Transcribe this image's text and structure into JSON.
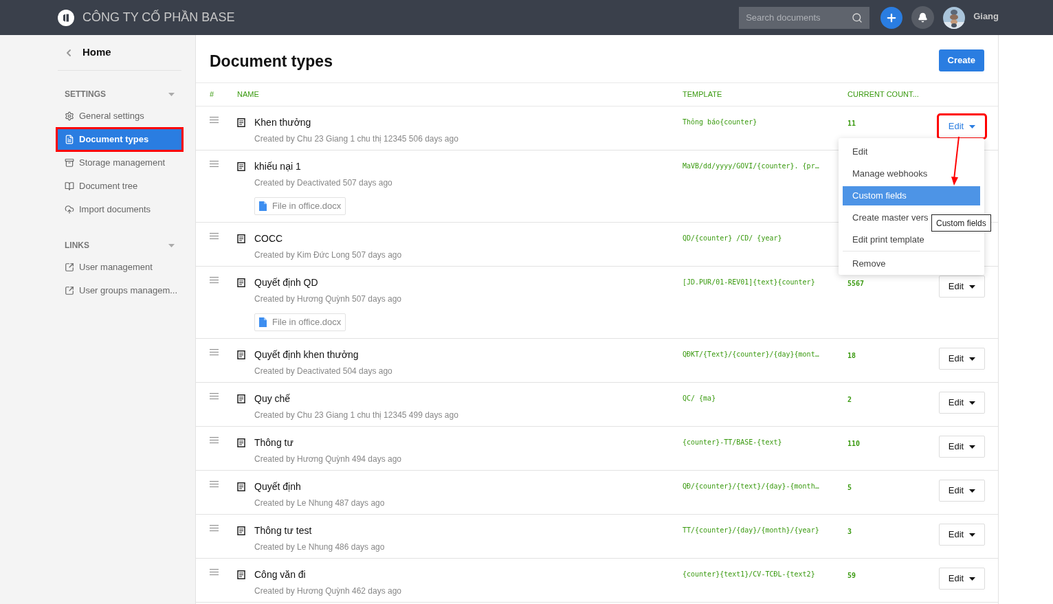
{
  "header": {
    "company": "CÔNG TY CỐ PHẦN BASE",
    "search": {
      "placeholder": "Search documents"
    },
    "user": "Giang"
  },
  "sidebar": {
    "back": "Home",
    "sections": [
      {
        "title": "SETTINGS",
        "items": [
          {
            "label": "General settings",
            "selected": false,
            "annotated": false
          },
          {
            "label": "Document types",
            "selected": true,
            "annotated": true
          },
          {
            "label": "Storage management",
            "selected": false,
            "annotated": false
          },
          {
            "label": "Document tree",
            "selected": false,
            "annotated": false
          },
          {
            "label": "Import documents",
            "selected": false,
            "annotated": false
          }
        ]
      },
      {
        "title": "LINKS",
        "items": [
          {
            "label": "User management",
            "selected": false,
            "annotated": false
          },
          {
            "label": "User groups managem...",
            "selected": false,
            "annotated": false
          }
        ]
      }
    ]
  },
  "page": {
    "title": "Document types",
    "create": "Create"
  },
  "table": {
    "columns": [
      "#",
      "NAME",
      "TEMPLATE",
      "CURRENT COUNT..."
    ],
    "rows": [
      {
        "name": "Khen thưởng",
        "creator": "Created by Chu 23 Giang 1 chu thị 12345 506 days ago",
        "template": "Thông báo{counter}",
        "count": "11",
        "edit": "Edit",
        "menu_open": true
      },
      {
        "name": "khiếu nại 1",
        "creator": "Created by Deactivated 507 days ago",
        "template": "MaVB/dd/yyyy/GOVI/{counter}. {pr…",
        "attachment": "File in office.docx",
        "menu_open": false
      },
      {
        "name": "COCC",
        "creator": "Created by Kim Đức Long 507 days ago",
        "template": "QD/{counter} /CD/ {year}",
        "menu_open": false
      },
      {
        "name": "Quyết định QD",
        "creator": "Created by Hương Quỳnh 507 days ago",
        "template": "[JD.PUR/01-REV01]{text}{counter}",
        "count": "5567",
        "edit": "Edit",
        "attachment": "File in office.docx",
        "menu_open": false
      },
      {
        "name": "Quyết định khen thưởng",
        "creator": "Created by Deactivated 504 days ago",
        "template": "QĐKT/{Text}/{counter}/{day}{mont…",
        "count": "18",
        "edit": "Edit",
        "menu_open": false
      },
      {
        "name": "Quy chế",
        "creator": "Created by Chu 23 Giang 1 chu thị 12345 499 days ago",
        "template": "QC/ {ma}",
        "count": "2",
        "edit": "Edit",
        "menu_open": false
      },
      {
        "name": "Thông tư",
        "creator": "Created by Hương Quỳnh 494 days ago",
        "template": "{counter}-TT/BASE-{text}",
        "count": "110",
        "edit": "Edit",
        "menu_open": false
      },
      {
        "name": "Quyết định",
        "creator": "Created by Le Nhung 487 days ago",
        "template": "QĐ/{counter}/{text}/{day}-{month…",
        "count": "5",
        "edit": "Edit",
        "menu_open": false
      },
      {
        "name": "Thông tư test",
        "creator": "Created by Le Nhung 486 days ago",
        "template": "TT/{counter}/{day}/{month}/{year}",
        "count": "3",
        "edit": "Edit",
        "menu_open": false
      },
      {
        "name": "Công văn đi",
        "creator": "Created by Hương Quỳnh 462 days ago",
        "template": "{counter}{text1}/CV-TCĐL-{text2}",
        "count": "59",
        "edit": "Edit",
        "menu_open": false
      }
    ]
  },
  "menu": {
    "items": [
      {
        "label": "Edit",
        "selected": false
      },
      {
        "label": "Manage webhooks",
        "selected": false
      },
      {
        "label": "Custom fields",
        "selected": true
      },
      {
        "label": "Create master vers",
        "selected": false
      },
      {
        "label": "Edit print template",
        "selected": false
      },
      {
        "label": "Remove",
        "selected": false,
        "divider_before": true
      }
    ],
    "tooltip": "Custom fields"
  }
}
